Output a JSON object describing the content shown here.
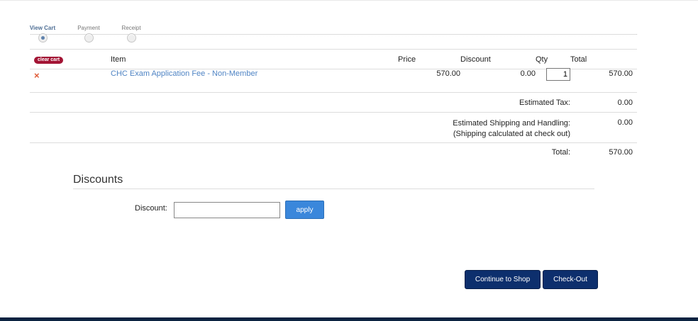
{
  "steps": [
    {
      "label": "View Cart",
      "active": true
    },
    {
      "label": "Payment",
      "active": false
    },
    {
      "label": "Receipt",
      "active": false
    }
  ],
  "cart": {
    "clear_label": "clear cart",
    "headers": {
      "item": "Item",
      "price": "Price",
      "discount": "Discount",
      "qty": "Qty",
      "total": "Total"
    },
    "items": [
      {
        "remove_icon": "×",
        "name": "CHC Exam Application Fee - Non-Member",
        "price": "570.00",
        "discount": "0.00",
        "qty": "1",
        "total": "570.00"
      }
    ],
    "tax_label": "Estimated Tax:",
    "tax_value": "0.00",
    "shipping_label": "Estimated Shipping and Handling:",
    "shipping_note": "(Shipping calculated at check out)",
    "shipping_value": "0.00",
    "total_label": "Total:",
    "total_value": "570.00"
  },
  "discounts": {
    "heading": "Discounts",
    "label": "Discount:",
    "value": "",
    "apply_label": "apply"
  },
  "actions": {
    "continue_label": "Continue to Shop",
    "checkout_label": "Check-Out"
  },
  "colors": {
    "accent": "#3a87db",
    "primary_dark": "#0d2f6d",
    "link": "#4f84c4",
    "badge": "#a31535",
    "footer": "#0b2341"
  }
}
